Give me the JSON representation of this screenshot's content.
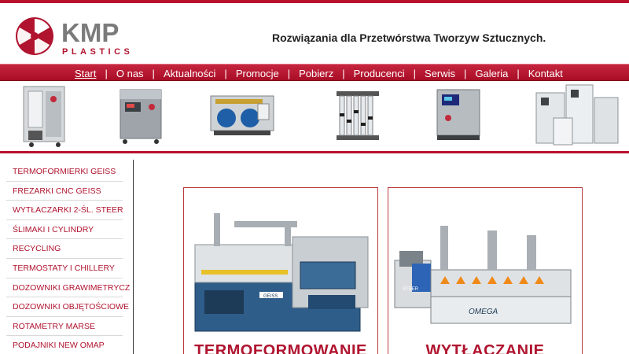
{
  "header": {
    "logo": {
      "brand": "KMP",
      "sub": "PLASTICS"
    },
    "tagline": "Rozwiązania dla Przetwórstwa Tworzyw Sztucznych."
  },
  "nav": {
    "items": [
      "Start",
      "O nas",
      "Aktualności",
      "Promocje",
      "Pobierz",
      "Producenci",
      "Serwis",
      "Galeria",
      "Kontakt"
    ],
    "separator": "|"
  },
  "products_strip": [
    "chiller-unit-image",
    "temperature-controller-image",
    "pump-unit-image",
    "rotameter-manifold-image",
    "thermostat-image",
    "industrial-chillers-image"
  ],
  "sidebar": {
    "items": [
      "TERMOFORMIERKI GEISS",
      "FREZARKI CNC GEISS",
      "WYTŁACZARKI 2-ŚL. STEER",
      "ŚLIMAKI I CYLINDRY",
      "RECYCLING",
      "TERMOSTATY I CHILLERY",
      "DOZOWNIKI GRAWIMETRYCZ",
      "DOZOWNIKI OBJĘTOŚCIOWE",
      "ROTAMETRY MARSE",
      "PODAJNIKI NEW OMAP"
    ]
  },
  "cards": [
    {
      "title": "TERMOFORMOWANIE",
      "machine_label": "GEISS"
    },
    {
      "title": "WYTŁACZANIE",
      "machine_label": "STEER",
      "model": "OMEGA"
    }
  ],
  "colors": {
    "brand": "#b0142f",
    "nav_bg": "#b8112e",
    "text": "#222222"
  }
}
